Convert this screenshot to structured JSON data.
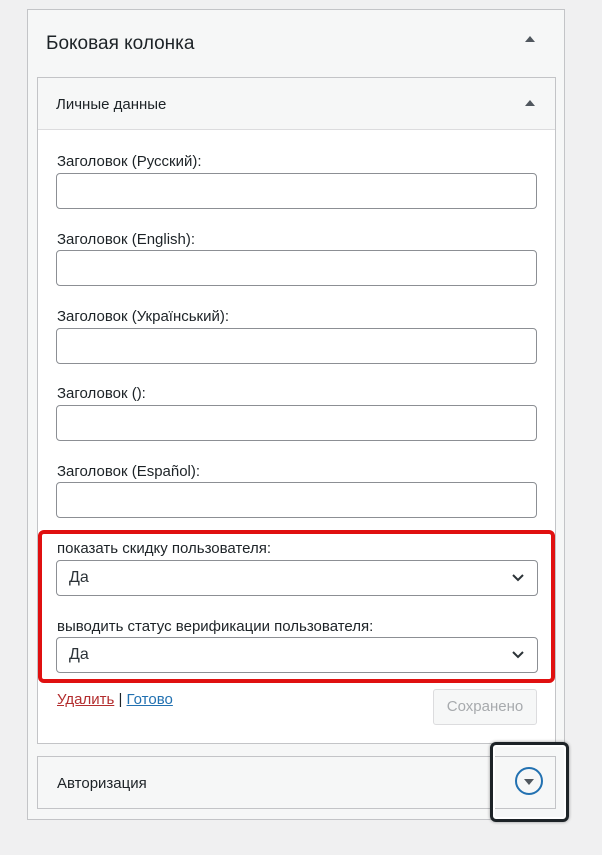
{
  "sidebar": {
    "title": "Боковая колонка"
  },
  "widget": {
    "title": "Личные данные",
    "fields": [
      {
        "label": "Заголовок (Русский):",
        "value": ""
      },
      {
        "label": "Заголовок (English):",
        "value": ""
      },
      {
        "label": "Заголовок (Український):",
        "value": ""
      },
      {
        "label": "Заголовок ():",
        "value": ""
      },
      {
        "label": "Заголовок (Español):",
        "value": ""
      }
    ],
    "selects": [
      {
        "label": "показать скидку пользователя:",
        "value": "Да"
      },
      {
        "label": "выводить статус верификации пользователя:",
        "value": "Да"
      }
    ],
    "delete_label": "Удалить",
    "separator": "|",
    "done_label": "Готово",
    "saved_label": "Сохранено"
  },
  "auth_widget": {
    "title": "Авторизация"
  },
  "icons": {
    "collapse": "arrow-up-icon",
    "expand": "arrow-down-icon",
    "select": "chevron-down-icon"
  },
  "colors": {
    "highlight": "#e01010",
    "link": "#2271b1",
    "delete": "#b32d2e"
  }
}
